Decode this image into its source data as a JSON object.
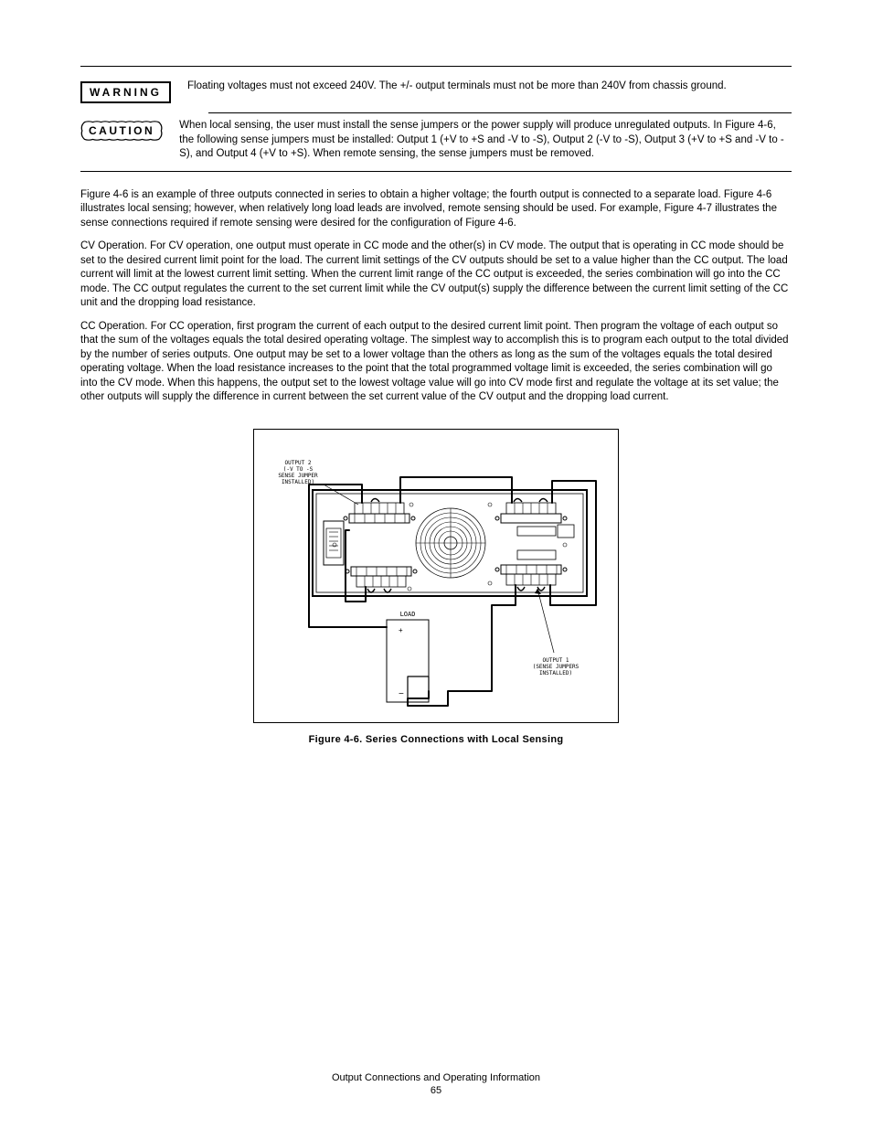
{
  "warning": {
    "label": "WARNING",
    "text": "Floating voltages must not exceed 240V. The +/- output terminals must not be more than 240V from chassis ground."
  },
  "caution": {
    "label": "CAUTION",
    "text": "When local sensing, the user must install the sense jumpers or the power supply will produce unregulated outputs. In Figure 4-6, the following sense jumpers must be installed: Output 1 (+V to +S and -V to -S), Output 2 (-V to -S), Output 3 (+V to +S and -V to - S), and Output 4 (+V to +S). When remote sensing, the sense jumpers must be removed."
  },
  "body": [
    "Figure 4-6 is an example of three outputs connected in series to obtain a higher voltage; the fourth output is connected to a separate load. Figure 4-6 illustrates local sensing; however, when relatively long load leads are involved, remote sensing should be used. For example, Figure 4-7 illustrates the sense connections required if remote sensing were desired for the configuration of Figure 4-6.",
    "CV Operation. For CV operation, one output must operate in CC mode and the other(s) in CV mode. The output that is operating in CC mode should be set to the desired current limit point for the load. The current limit settings of the CV outputs should be set to a value higher than the CC output. The load current will limit at the lowest current limit setting. When the current limit range of the CC output is exceeded, the series combination will go into the CC mode. The CC output regulates the current to the set current limit while the CV output(s) supply the difference between the current limit setting of the CC unit and the dropping load resistance.",
    "CC Operation. For CC operation, first program the current of each output to the desired current limit point. Then program the voltage of each output so that the sum of the voltages equals the total desired operating voltage. The simplest way to accomplish this is to program each output to the total divided by the number of series outputs. One output may be set to a lower voltage than the others as long as the sum of the voltages equals the total desired operating voltage. When the load resistance increases to the point that the total programmed voltage limit is exceeded, the series combination will go into the CV mode. When this happens, the output set to the lowest voltage value will go into CV mode first and regulate the voltage at its set value; the other outputs will supply the difference in current between the set current value of the CV output and the dropping load current."
  ],
  "figure": {
    "labelOutput2a": "OUTPUT 2",
    "labelOutput2b": "(-V TO -S",
    "labelOutput2c": "SENSE JUMPER",
    "labelOutput2d": "INSTALLED)",
    "labelLoad": "LOAD",
    "labelOutput1a": "OUTPUT 1",
    "labelOutput1b": "(SENSE JUMPERS",
    "labelOutput1c": "INSTALLED)",
    "caption": "Figure 4-6. Series Connections with Local Sensing"
  },
  "footer": {
    "section": "Output Connections and Operating Information",
    "page": "65"
  }
}
